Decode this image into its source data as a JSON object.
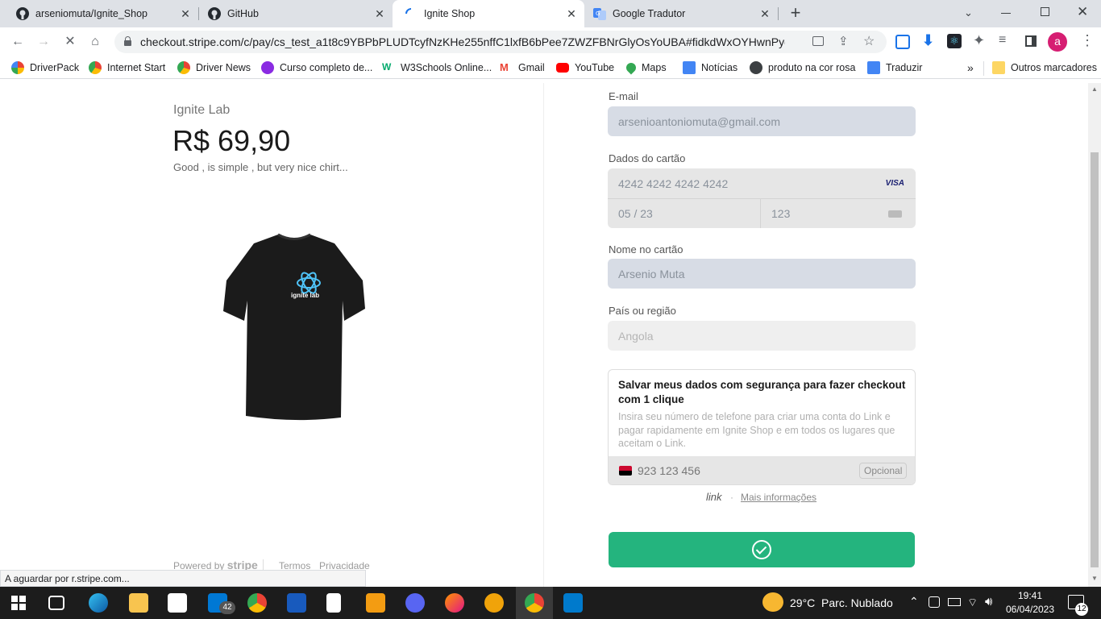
{
  "browser": {
    "tabs": [
      {
        "label": "arseniomuta/Ignite_Shop",
        "icon": "github-icon"
      },
      {
        "label": "GitHub",
        "icon": "github-icon"
      },
      {
        "label": "Ignite Shop",
        "icon": "loading-spinner-icon"
      },
      {
        "label": "Google Tradutor",
        "icon": "google-translate-icon"
      }
    ],
    "new_tab": "+",
    "url": "checkout.stripe.com/c/pay/cs_test_a1t8c9YBPbPLUDTcyfNzKHe255nffC1lxfB6bPee7ZWZFBNrGlyOsYoUBA#fidkdWxOYHwnPyd1blpx...",
    "profile_initial": "a",
    "bookmarks": [
      "DriverPack",
      "Internet Start",
      "Driver News",
      "Curso completo de...",
      "W3Schools Online...",
      "Gmail",
      "YouTube",
      "Maps",
      "Notícias",
      "produto na cor rosa",
      "Traduzir"
    ],
    "bookmarks_more": "»",
    "other_bookmarks": "Outros marcadores",
    "status": "A aguardar por r.stripe.com..."
  },
  "product": {
    "seller": "Ignite Lab",
    "price": "R$ 69,90",
    "description": "Good , is simple , but very nice chirt...",
    "shirt_logo": "ignite lab",
    "footer_powered": "Powered by",
    "footer_brand": "stripe",
    "footer_terms": "Termos",
    "footer_privacy": "Privacidade"
  },
  "form": {
    "email_label": "E-mail",
    "email_value": "arsenioantoniomuta@gmail.com",
    "card_label": "Dados do cartão",
    "card_number": "4242 4242 4242 4242",
    "card_brand": "VISA",
    "card_expiry": "05 / 23",
    "card_cvc": "123",
    "name_label": "Nome no cartão",
    "name_value": "Arsenio Muta",
    "country_label": "País ou região",
    "country_value": "Angola",
    "link_title": "Salvar meus dados com segurança para fazer checkout com 1 clique",
    "link_desc": "Insira seu número de telefone para criar uma conta do Link e pagar rapidamente em Ignite Shop e em todos os lugares que aceitam o Link.",
    "phone_value": "923 123 456",
    "phone_optional": "Opcional",
    "link_brand": "link",
    "link_dot": "·",
    "link_more": "Mais informações",
    "submit_color": "#24b47e"
  },
  "taskbar": {
    "mail_badge": "42",
    "weather": "29°C  Parc. Nublado",
    "time": "19:41",
    "date": "06/04/2023",
    "notifications": "12"
  }
}
